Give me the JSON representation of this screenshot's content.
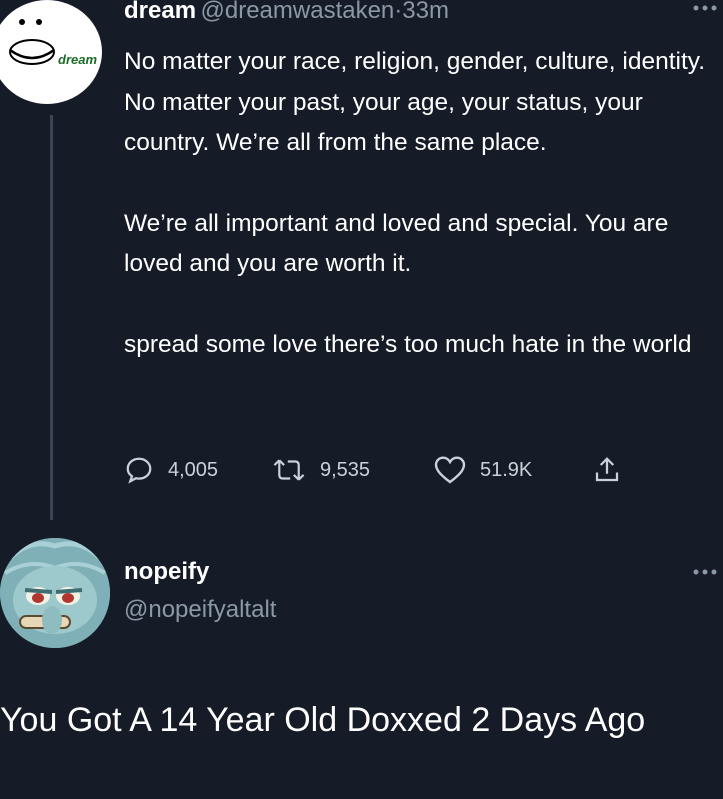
{
  "tweet": {
    "author_name": "dream",
    "author_handle": "@dreamwastaken",
    "separator": "·",
    "time": "33m",
    "avatar_text": "dream",
    "paragraphs": [
      "No matter your race, religion, gender, culture, identity. No matter your past, your age, your status, your country. We’re all from the same place.",
      "We’re all important and loved and special. You are loved and you are worth it.",
      "spread some love there’s too much hate in the world"
    ],
    "stats": {
      "replies": "4,005",
      "retweets": "9,535",
      "likes": "51.9K"
    },
    "icons": {
      "reply": "reply-icon",
      "retweet": "retweet-icon",
      "like": "heart-icon",
      "share": "share-icon",
      "more": "more-icon"
    }
  },
  "reply": {
    "author_name": "nopeify",
    "author_handle": "@nopeifyaltalt"
  },
  "caption": "You Got A 14 Year Old Doxxed 2 Days Ago",
  "colors": {
    "background": "#151c27",
    "text": "#ffffff",
    "muted": "#8b98a5",
    "avatar_green": "#1c6b28"
  }
}
